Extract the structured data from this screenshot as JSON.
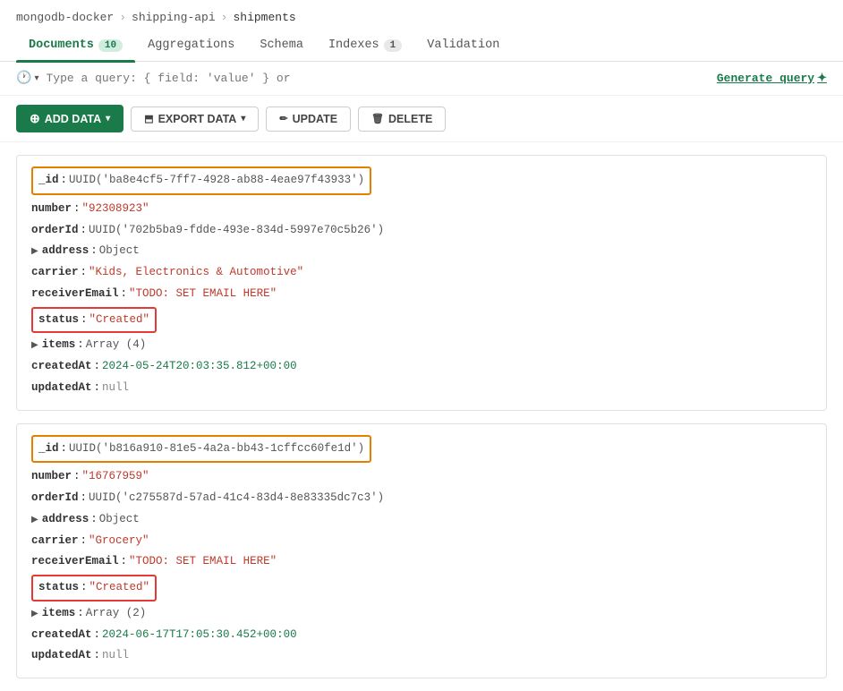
{
  "breadcrumb": {
    "parts": [
      "mongodb-docker",
      "shipping-api",
      "shipments"
    ],
    "separators": [
      ">",
      ">"
    ]
  },
  "tabs": [
    {
      "label": "Documents",
      "badge": "10",
      "active": true
    },
    {
      "label": "Aggregations",
      "badge": null,
      "active": false
    },
    {
      "label": "Schema",
      "badge": null,
      "active": false
    },
    {
      "label": "Indexes",
      "badge": "1",
      "active": false
    },
    {
      "label": "Validation",
      "badge": null,
      "active": false
    }
  ],
  "query_bar": {
    "placeholder": "Type a query: { field: 'value' } or",
    "generate_label": "Generate query",
    "sparkle": "✦"
  },
  "toolbar": {
    "add_data": "ADD DATA",
    "export_data": "EXPORT DATA",
    "update": "UPDATE",
    "delete": "DELETE"
  },
  "documents": [
    {
      "id_value": "UUID('ba8e4cf5-7ff7-4928-ab88-4eae97f43933')",
      "number": "\"92308923\"",
      "orderId": "UUID('702b5ba9-fdde-493e-834d-5997e70c5b26')",
      "address_type": "Object",
      "carrier": "\"Kids, Electronics & Automotive\"",
      "receiverEmail": "\"TODO: SET EMAIL HERE\"",
      "status": "\"Created\"",
      "items_count": "Array (4)",
      "createdAt": "2024-05-24T20:03:35.812+00:00",
      "updatedAt": "null"
    },
    {
      "id_value": "UUID('b816a910-81e5-4a2a-bb43-1cffcc60fe1d')",
      "number": "\"16767959\"",
      "orderId": "UUID('c275587d-57ad-41c4-83d4-8e83335dc7c3')",
      "address_type": "Object",
      "carrier": "\"Grocery\"",
      "receiverEmail": "\"TODO: SET EMAIL HERE\"",
      "status": "\"Created\"",
      "items_count": "Array (2)",
      "createdAt": "2024-06-17T17:05:30.452+00:00",
      "updatedAt": "null"
    }
  ]
}
